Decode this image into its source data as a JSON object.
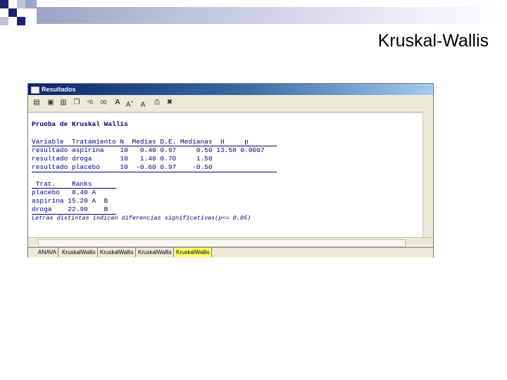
{
  "slide": {
    "title": "Kruskal-Wallis"
  },
  "window": {
    "title": "Resultados"
  },
  "toolbar": {
    "buttons": [
      {
        "icon": "open-icon",
        "glyph": "▤"
      },
      {
        "icon": "save-icon",
        "glyph": "▣"
      },
      {
        "icon": "delete-icon",
        "glyph": "▥"
      },
      {
        "icon": "copy-icon",
        "glyph": "❐"
      },
      {
        "icon": "decimals-increase-icon",
        "glyph": "⁰"
      },
      {
        "icon": "decimals-decrease-icon",
        "glyph": "₀"
      },
      {
        "icon": "font-icon",
        "glyph": "A"
      },
      {
        "icon": "font-size-icon",
        "glyph": "A"
      },
      {
        "icon": "font-size-icon",
        "glyph": "A"
      },
      {
        "icon": "print-icon",
        "glyph": "⎙"
      },
      {
        "icon": "close-panel-icon",
        "glyph": "✖"
      }
    ],
    "labels": [
      "0",
      "00",
      "+",
      "-"
    ]
  },
  "report": {
    "heading": "Prueba de Kruskal Wallis",
    "table_header": "Variable  Tratamiento N  Medias D.E. Medianas  H     p",
    "table_rows": [
      "resultado aspirina    10   0.40 0.97     0.50 13.58 0.0007",
      "resultado droga       10   1.40 0.70     1.50",
      "resultado placebo     10  -0.60 0.97    -0.50"
    ],
    "ranks_header": " Trat.    Ranks",
    "ranks_rows": [
      "placebo   8.40 A",
      "aspirina 15.20 A  B",
      "droga    22.90    B"
    ],
    "footnote": "Letras distintas indican diferencias significativas(p<= 0.05)"
  },
  "tabs": [
    {
      "label": "ANAVA",
      "active": false
    },
    {
      "label": "KruskalWallis",
      "active": false
    },
    {
      "label": "KruskalWallis",
      "active": false
    },
    {
      "label": "KruskalWallis",
      "active": false
    },
    {
      "label": "KruskalWallis",
      "active": true
    }
  ],
  "colors": {
    "output_text": "#00007a",
    "active_tab": "#ffff66",
    "titlebar": "#0a246a"
  }
}
